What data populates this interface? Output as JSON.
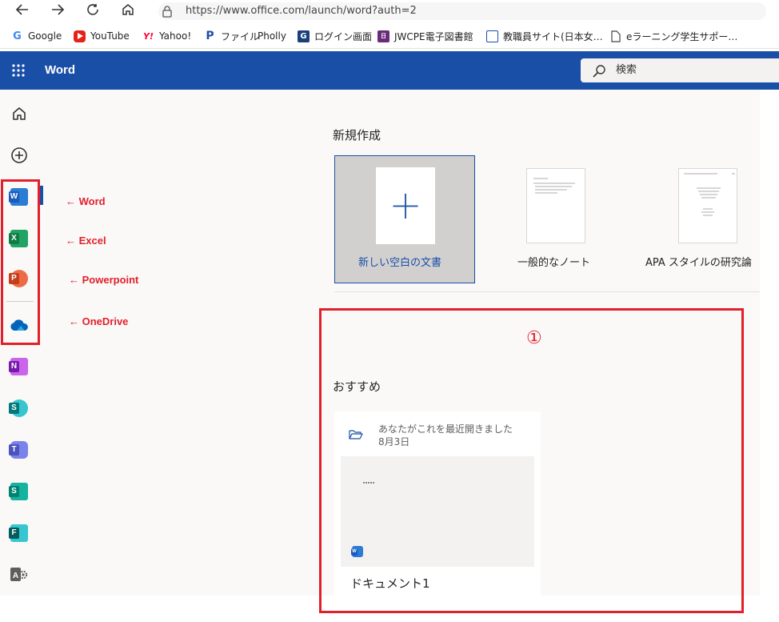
{
  "browser": {
    "url": "https://www.office.com/launch/word?auth=2",
    "bookmarks": [
      {
        "label": "Google"
      },
      {
        "label": "YouTube"
      },
      {
        "label": "Yahoo!"
      },
      {
        "label": "ファイル"
      },
      {
        "label": "Pholly"
      },
      {
        "label": "ログイン画面"
      },
      {
        "label": "JWCPE電子図書館"
      },
      {
        "label": "教職員サイト(日本女…"
      },
      {
        "label": "eラーニング学生サポー…"
      }
    ]
  },
  "suite_header": {
    "app_name": "Word",
    "search_placeholder": "検索"
  },
  "annotations": {
    "word": "← Word",
    "excel": "← Excel",
    "powerpoint": "← Powerpoint",
    "onedrive": "← OneDrive",
    "marker": "①"
  },
  "new_section": {
    "title": "新規作成",
    "templates": [
      {
        "label": "新しい空白の文書"
      },
      {
        "label": "一般的なノート"
      },
      {
        "label": "APA スタイルの研究論"
      }
    ]
  },
  "recommended": {
    "title": "おすすめ",
    "card": {
      "activity": "あなたがこれを最近開きました",
      "date": "8月3日",
      "doc_name": "ドキュメント1"
    }
  },
  "colors": {
    "suite_blue": "#1a4fa8",
    "annotation_red": "#e2202b",
    "word": "#185abd",
    "excel": "#107c41",
    "powerpoint": "#c43e1c",
    "onedrive": "#0364b8",
    "onenote": "#7719aa",
    "sharepoint": "#03787c",
    "teams": "#4b53bc",
    "sway": "#008272",
    "forms": "#035b5a",
    "admin": "#605e5c"
  }
}
